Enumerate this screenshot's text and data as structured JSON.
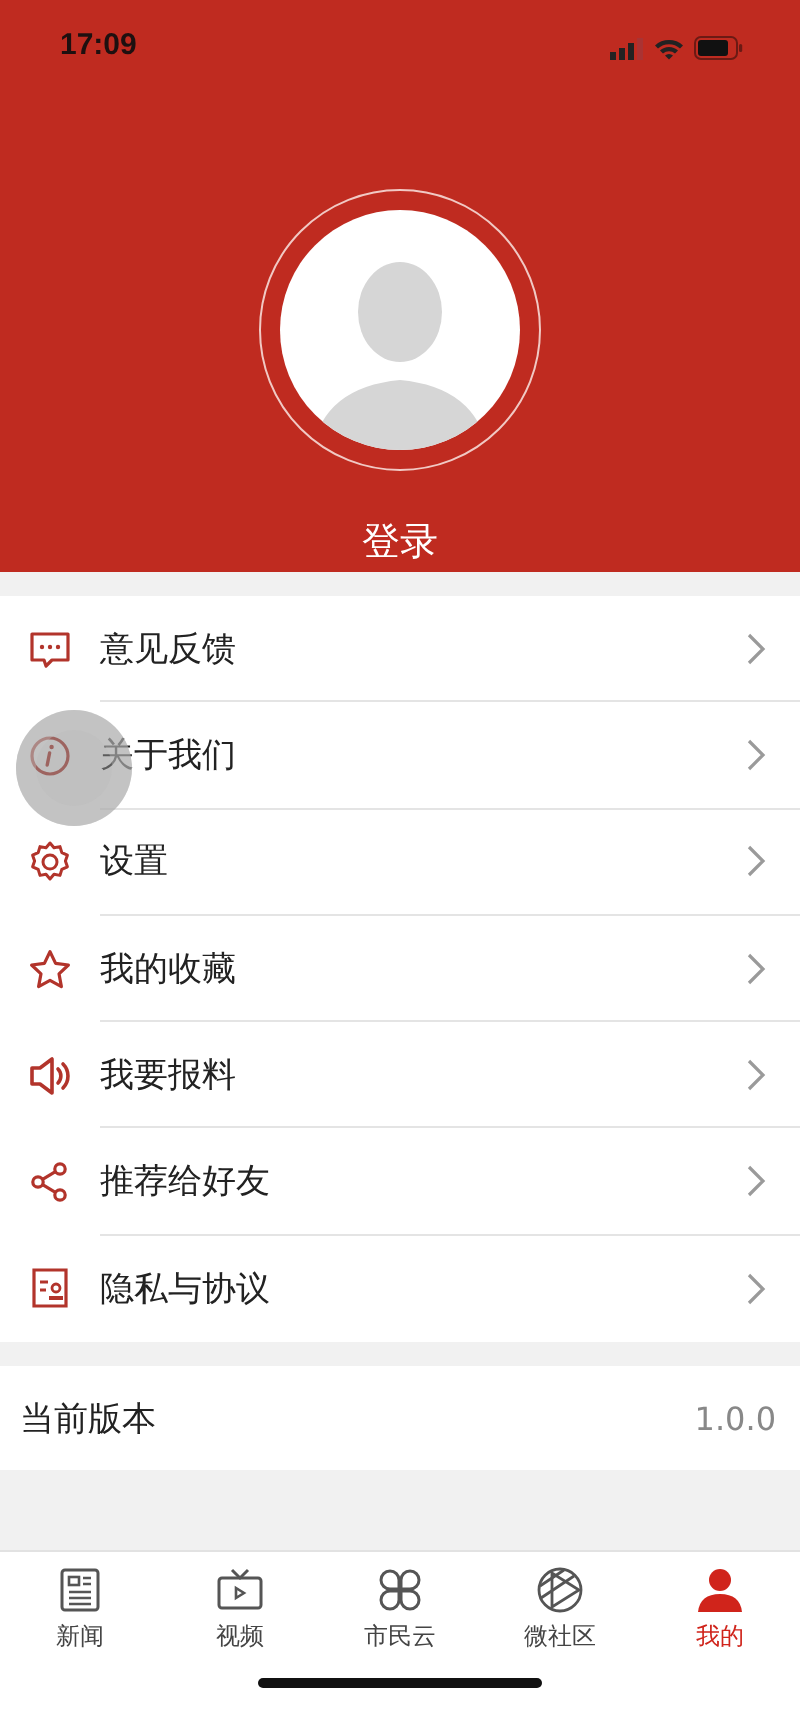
{
  "status_bar": {
    "time": "17:09"
  },
  "header": {
    "login": "登录"
  },
  "menu": [
    {
      "kind": "feedback",
      "label": "意见反馈"
    },
    {
      "kind": "about",
      "label": "关于我们"
    },
    {
      "kind": "settings",
      "label": "设置"
    },
    {
      "kind": "favorites",
      "label": "我的收藏"
    },
    {
      "kind": "report",
      "label": "我要报料"
    },
    {
      "kind": "share",
      "label": "推荐给好友"
    },
    {
      "kind": "privacy",
      "label": "隐私与协议"
    }
  ],
  "version": {
    "label": "当前版本",
    "value": "1.0.0"
  },
  "tabs": [
    {
      "kind": "news",
      "label": "新闻",
      "selected": false
    },
    {
      "kind": "video",
      "label": "视频",
      "selected": false
    },
    {
      "kind": "cloud",
      "label": "市民云",
      "selected": false
    },
    {
      "kind": "community",
      "label": "微社区",
      "selected": false
    },
    {
      "kind": "me",
      "label": "我的",
      "selected": true
    }
  ]
}
